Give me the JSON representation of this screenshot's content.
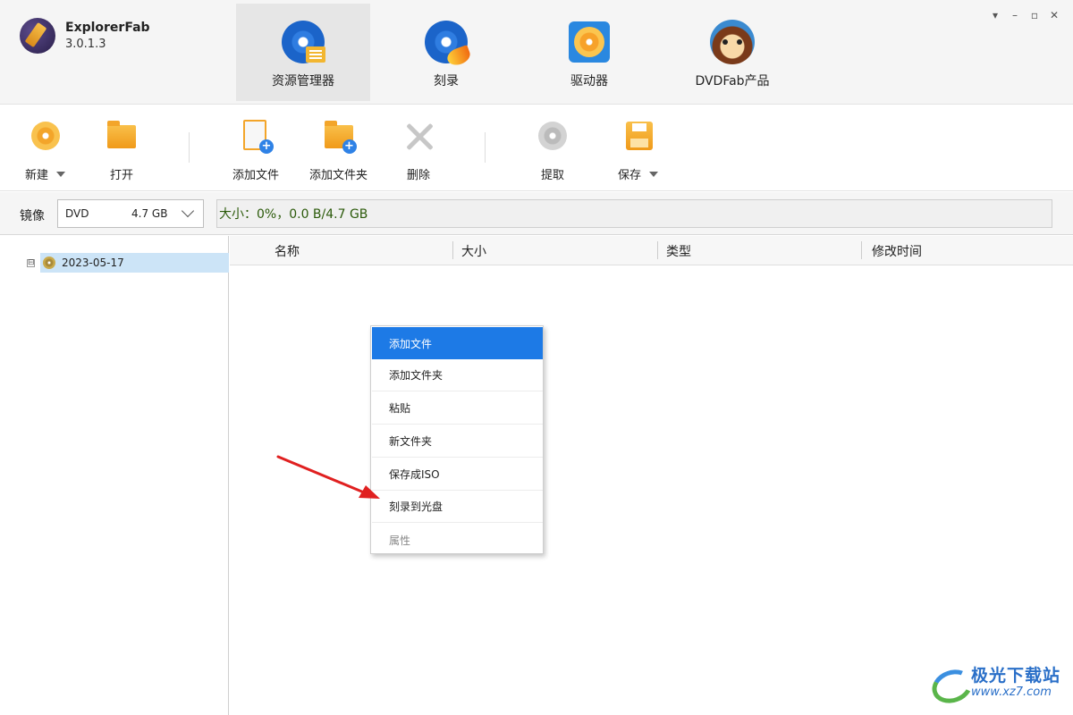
{
  "app": {
    "name": "ExplorerFab",
    "version": "3.0.1.3"
  },
  "nav_tabs": [
    {
      "label": "资源管理器",
      "icon": "disc-list-icon",
      "active": true
    },
    {
      "label": "刻录",
      "icon": "disc-burn-icon",
      "active": false
    },
    {
      "label": "驱动器",
      "icon": "drive-icon",
      "active": false
    },
    {
      "label": "DVDFab产品",
      "icon": "dvdfab-monkey-icon",
      "active": false
    }
  ],
  "window_controls": [
    "menu-down-icon",
    "minimize-icon",
    "maximize-icon",
    "close-icon"
  ],
  "toolbar": {
    "new": "新建",
    "open": "打开",
    "add_file": "添加文件",
    "add_folder": "添加文件夹",
    "delete": "删除",
    "extract": "提取",
    "save": "保存"
  },
  "image_bar": {
    "label": "镜像",
    "disc_type": "DVD",
    "disc_size": "4.7 GB",
    "size_status": "大小：0%，0.0 B/4.7 GB"
  },
  "tree": {
    "toggle": "⊟",
    "root_label": "2023-05-17"
  },
  "list_columns": [
    "名称",
    "大小",
    "类型",
    "修改时间"
  ],
  "context_menu": [
    {
      "label": "添加文件",
      "state": "highlighted"
    },
    {
      "label": "添加文件夹",
      "state": "normal"
    },
    {
      "label": "粘贴",
      "state": "normal"
    },
    {
      "label": "新文件夹",
      "state": "normal"
    },
    {
      "label": "保存成ISO",
      "state": "normal"
    },
    {
      "label": "刻录到光盘",
      "state": "normal"
    },
    {
      "label": "属性",
      "state": "disabled"
    }
  ],
  "colors": {
    "accent": "#1d7ae6",
    "arrow": "#e02020",
    "status_text": "#2b5a0a"
  },
  "watermark": {
    "cn": "极光下载站",
    "url": "www.xz7.com"
  }
}
